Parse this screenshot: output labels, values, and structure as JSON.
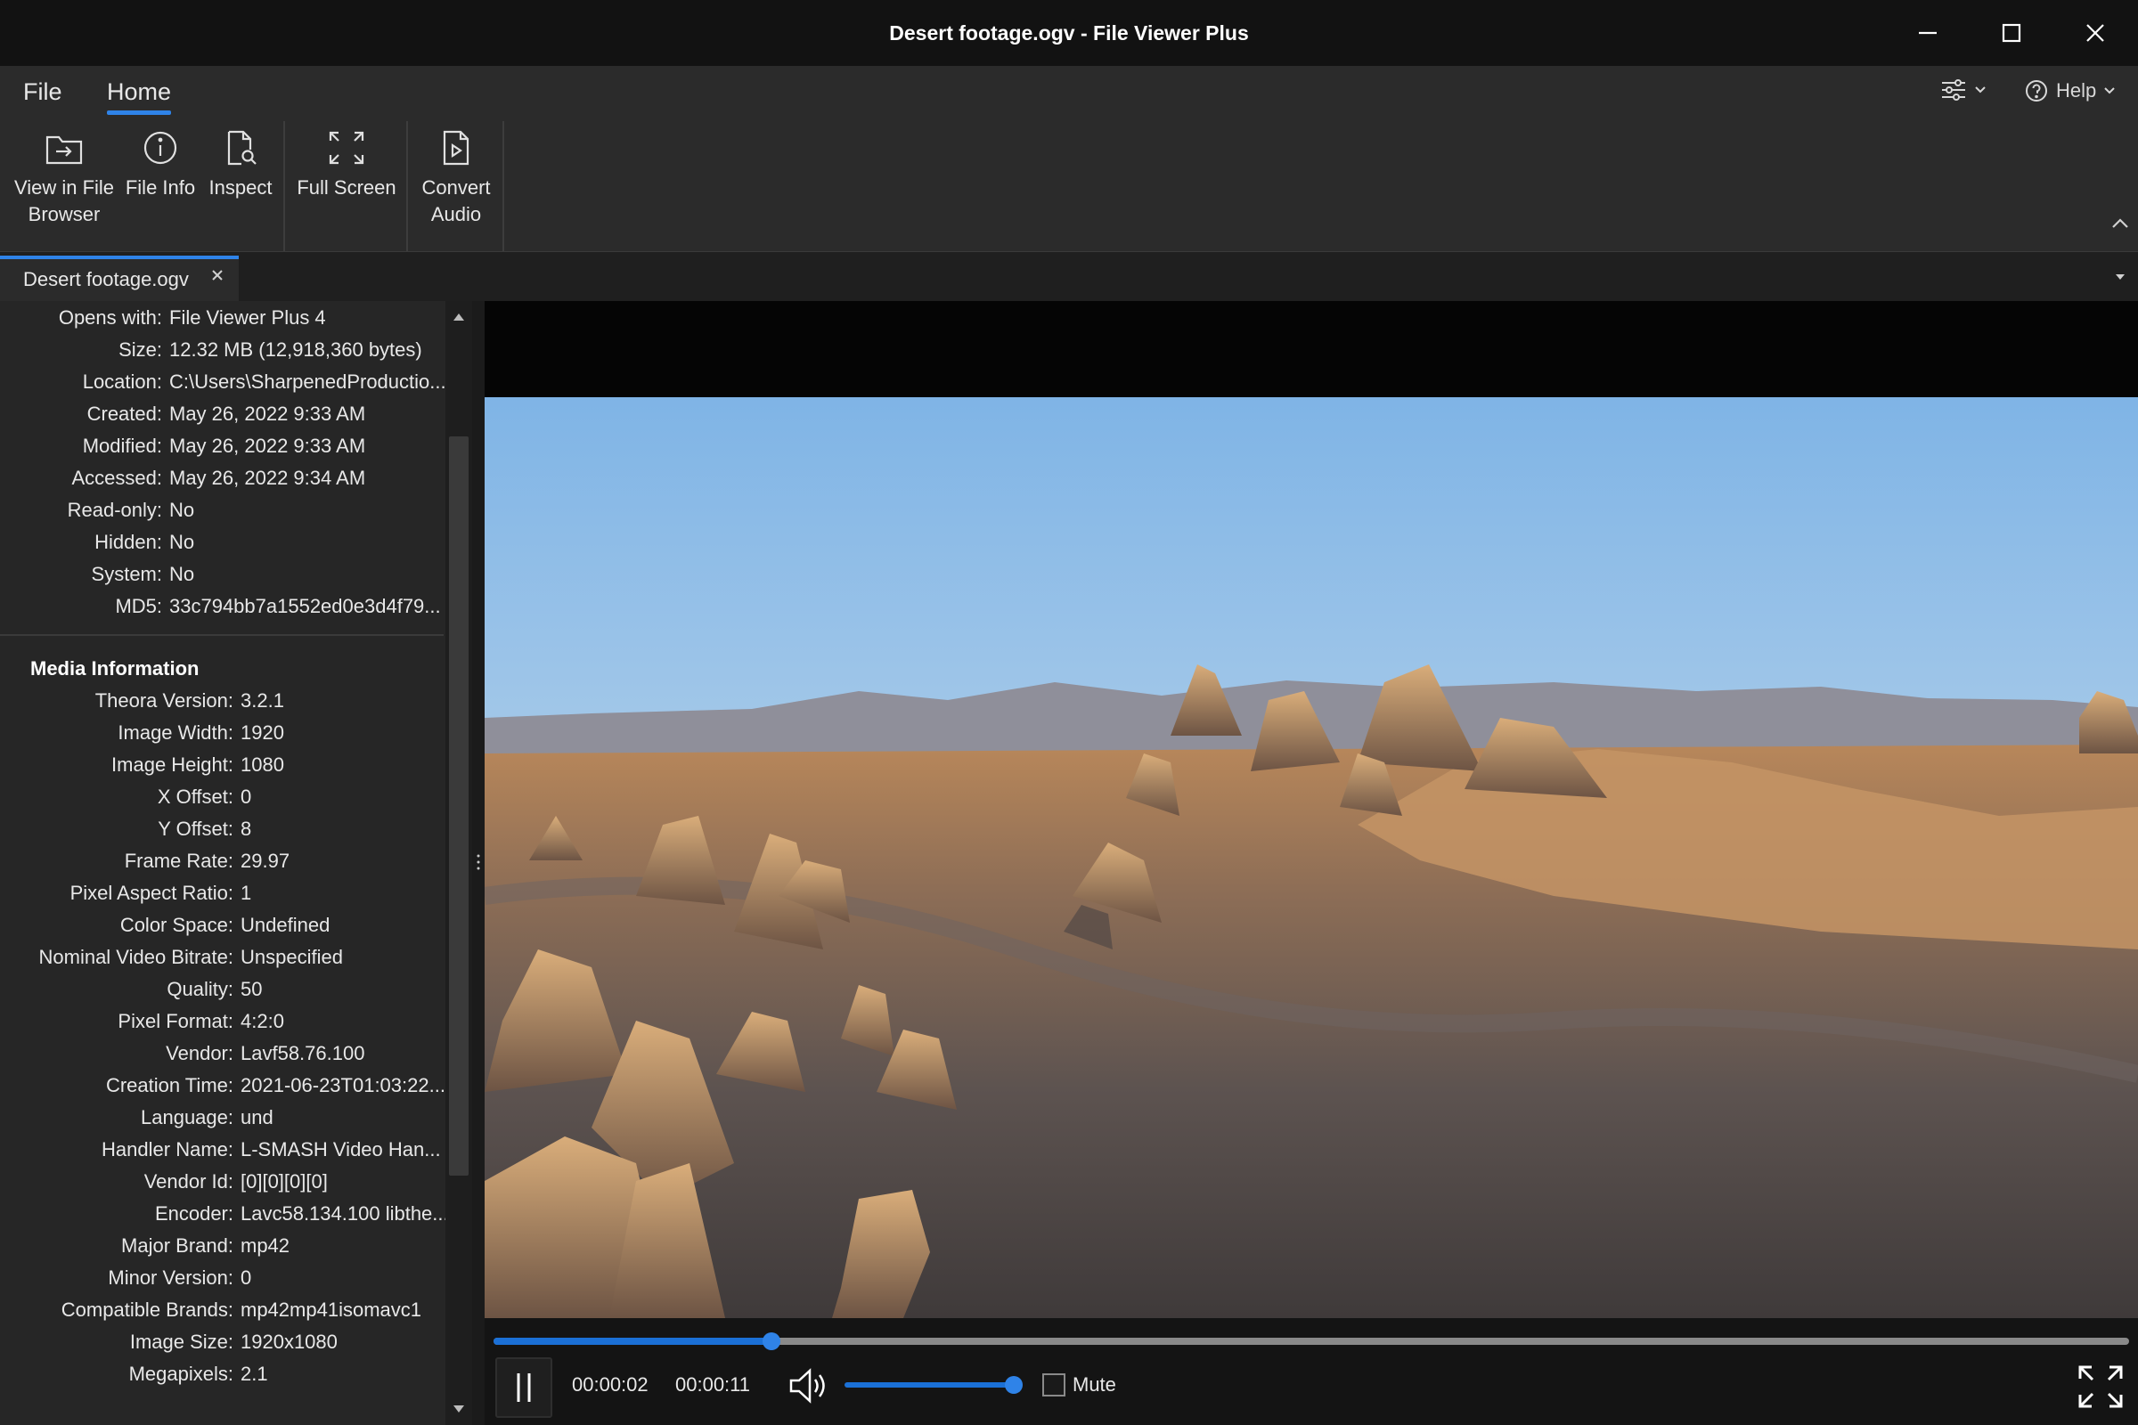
{
  "window": {
    "title": "Desert footage.ogv - File Viewer Plus"
  },
  "menu": {
    "file": "File",
    "home": "Home",
    "help": "Help"
  },
  "ribbon": {
    "view_in_browser_1": "View in File",
    "view_in_browser_2": "Browser",
    "file_info": "File Info",
    "inspect": "Inspect",
    "full_screen": "Full Screen",
    "convert_audio_1": "Convert",
    "convert_audio_2": "Audio"
  },
  "tab": {
    "label": "Desert footage.ogv"
  },
  "file_props": [
    {
      "k": "Opens with:",
      "v": "File Viewer Plus 4"
    },
    {
      "k": "Size:",
      "v": "12.32 MB (12,918,360 bytes)"
    },
    {
      "k": "Location:",
      "v": "C:\\Users\\SharpenedProductio..."
    },
    {
      "k": "Created:",
      "v": "May 26, 2022 9:33 AM"
    },
    {
      "k": "Modified:",
      "v": "May 26, 2022 9:33 AM"
    },
    {
      "k": "Accessed:",
      "v": "May 26, 2022 9:34 AM"
    },
    {
      "k": "Read-only:",
      "v": "No"
    },
    {
      "k": "Hidden:",
      "v": "No"
    },
    {
      "k": "System:",
      "v": "No"
    },
    {
      "k": "MD5:",
      "v": "33c794bb7a1552ed0e3d4f79..."
    }
  ],
  "media_title": "Media Information",
  "media_props": [
    {
      "k": "Theora Version:",
      "v": "3.2.1"
    },
    {
      "k": "Image Width:",
      "v": "1920"
    },
    {
      "k": "Image Height:",
      "v": "1080"
    },
    {
      "k": "X Offset:",
      "v": "0"
    },
    {
      "k": "Y Offset:",
      "v": "8"
    },
    {
      "k": "Frame Rate:",
      "v": "29.97"
    },
    {
      "k": "Pixel Aspect Ratio:",
      "v": "1"
    },
    {
      "k": "Color Space:",
      "v": "Undefined"
    },
    {
      "k": "Nominal Video Bitrate:",
      "v": "Unspecified"
    },
    {
      "k": "Quality:",
      "v": "50"
    },
    {
      "k": "Pixel Format:",
      "v": "4:2:0"
    },
    {
      "k": "Vendor:",
      "v": "Lavf58.76.100"
    },
    {
      "k": "Creation Time:",
      "v": "2021-06-23T01:03:22..."
    },
    {
      "k": "Language:",
      "v": "und"
    },
    {
      "k": "Handler Name:",
      "v": "L-SMASH Video Han..."
    },
    {
      "k": "Vendor Id:",
      "v": "[0][0][0][0]"
    },
    {
      "k": "Encoder:",
      "v": "Lavc58.134.100 libthe..."
    },
    {
      "k": "Major Brand:",
      "v": "mp42"
    },
    {
      "k": "Minor Version:",
      "v": "0"
    },
    {
      "k": "Compatible Brands:",
      "v": "mp42mp41isomavc1"
    },
    {
      "k": "Image Size:",
      "v": "1920x1080"
    },
    {
      "k": "Megapixels:",
      "v": "2.1"
    }
  ],
  "player": {
    "current_time": "00:00:02",
    "duration": "00:00:11",
    "progress": 0.17,
    "volume": 1.0,
    "mute_label": "Mute",
    "muted": false
  },
  "colors": {
    "accent": "#2f83e8",
    "background": "#202020"
  }
}
